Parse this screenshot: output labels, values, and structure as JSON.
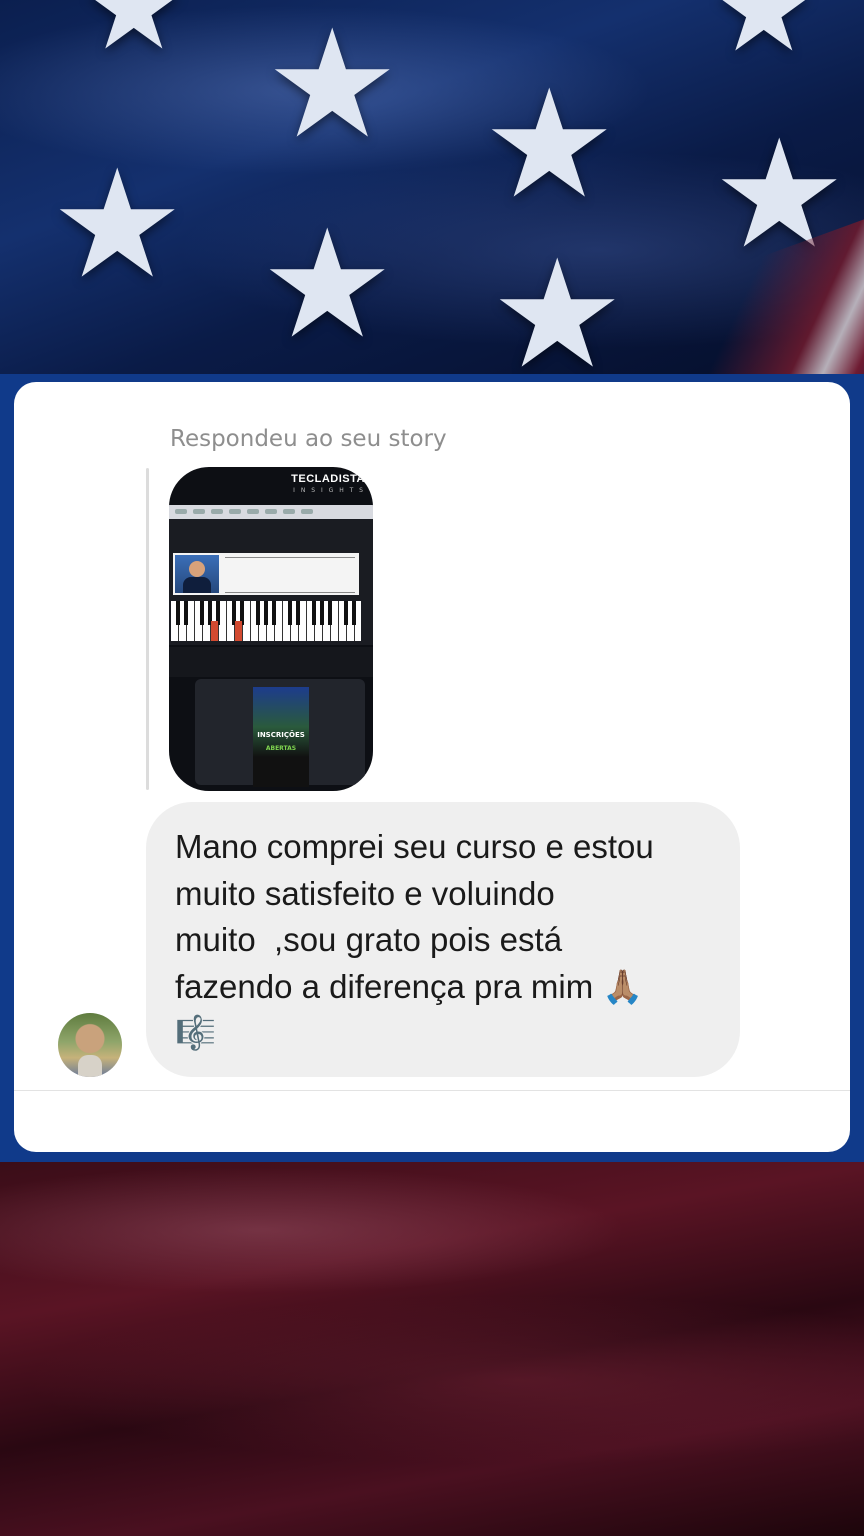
{
  "background": {
    "top_color": "#0b1f4f",
    "bottom_color": "#3a0d18",
    "star_glyph": "★"
  },
  "conversation": {
    "reply_context": "Respondeu ao seu story",
    "story_thumbnail": {
      "brand": "TECLADISTA",
      "brand_sub": "I N S I G H T S",
      "poster_line1": "INSCRIÇÕES",
      "poster_line2": "ABERTAS"
    },
    "message": {
      "text": "Mano comprei seu curso e estou\nmuito satisfeito e voluindo\nmuito  ,sou grato pois está\nfazendo a diferença pra mim 🙏🏽\n🎼"
    },
    "sender_avatar": "avatar-icon"
  }
}
